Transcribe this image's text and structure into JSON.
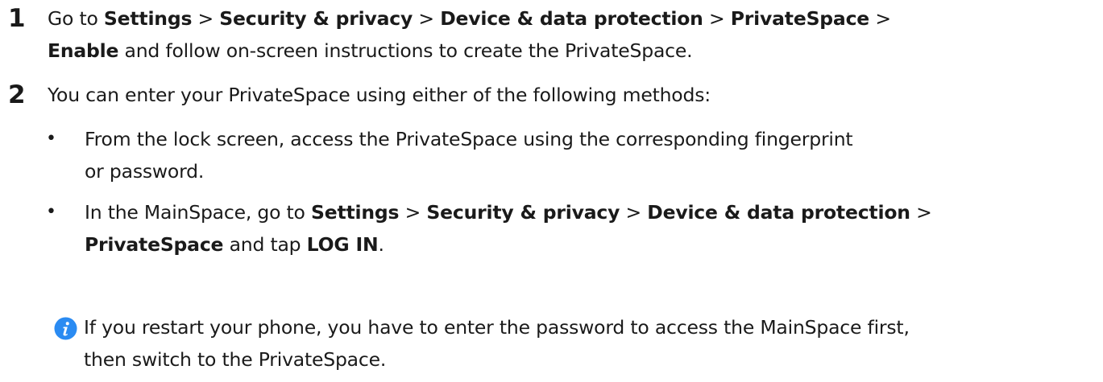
{
  "steps": [
    {
      "number": "1",
      "line1": {
        "p1": "Go to ",
        "b1": "Settings",
        "p2": " > ",
        "b2": "Security & privacy",
        "p3": " > ",
        "b3": "Device & data protection",
        "p4": " > ",
        "b4": "PrivateSpace",
        "p5": " >"
      },
      "line2": {
        "b1": "Enable",
        "p1": " and follow on-screen instructions to create the PrivateSpace."
      }
    },
    {
      "number": "2",
      "text": "You can enter your PrivateSpace using either of the following methods:"
    }
  ],
  "bullets": [
    {
      "symbol": "•",
      "line1": "From the lock screen, access the PrivateSpace using the corresponding fingerprint",
      "line2": "or password."
    },
    {
      "symbol": "•",
      "line1": {
        "p1": "In the MainSpace, go to ",
        "b1": "Settings",
        "p2": " > ",
        "b2": "Security & privacy",
        "p3": " > ",
        "b3": "Device & data protection",
        "p4": " >"
      },
      "line2": {
        "b1": "PrivateSpace",
        "p1": " and tap ",
        "b2": "LOG IN",
        "p2": "."
      }
    }
  ],
  "note": {
    "icon": "info-icon",
    "icon_color": "#2a8bf2",
    "line1": "If you restart your phone, you have to enter the password to access the MainSpace first,",
    "line2": "then switch to the PrivateSpace."
  }
}
